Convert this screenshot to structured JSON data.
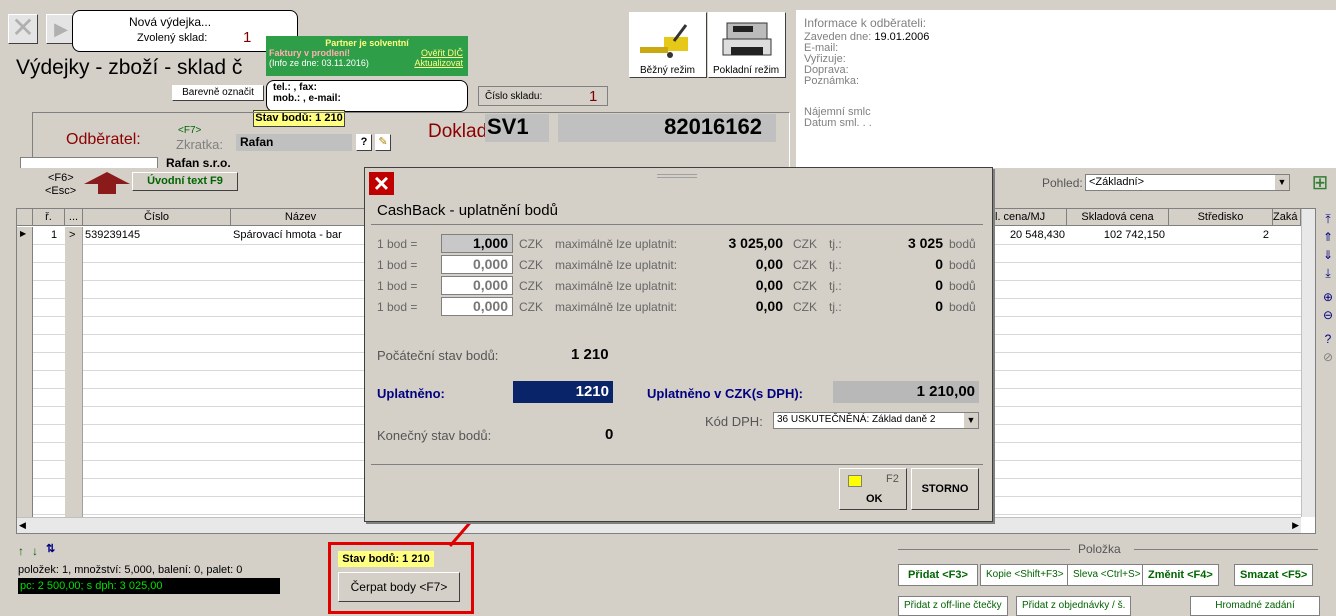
{
  "top": {
    "title": "Výdejky - zboží - sklad č",
    "callout_new": "Nová výdejka...",
    "callout_warehouse_label": "Zvolený sklad:",
    "callout_warehouse_value": "1",
    "partner_title": "Partner je solventní",
    "partner_invoices": "Faktury v prodlení!",
    "partner_verify": "Ověřit DIČ",
    "partner_info": "(Info ze dne: 03.11.2016)",
    "partner_update": "Aktualizovat",
    "color_button": "Barevně označit",
    "contact_line1": "tel.: , fax:",
    "contact_line2": "mob.: , e-mail:",
    "points_state": "Stav bodů: 1 210",
    "warehouse_no_label": "Číslo skladu:",
    "warehouse_no_value": "1",
    "mode_normal": "Běžný režim",
    "mode_cash": "Pokladní režim"
  },
  "customer": {
    "label": "Odběratel:",
    "f7": "<F7>",
    "short_label": "Zkratka:",
    "short_value": "Rafan",
    "help_btn": "?",
    "name_partial": "Rafan s.r.o.",
    "doc_label": "Doklad:",
    "doc_series": "SV1",
    "doc_number": "82016162"
  },
  "info": {
    "title": "Informace k odběrateli:",
    "created_label": "Zaveden dne:",
    "created_value": "19.01.2006",
    "email": "E-mail:",
    "handles": "Vyřizuje:",
    "transport": "Doprava:",
    "note": "Poznámka:",
    "lease": "Nájemní smlc",
    "lease_date": "Datum sml.   . ."
  },
  "toolbar": {
    "f6": "<F6>",
    "esc": "<Esc>",
    "intro_text": "Úvodní text F9",
    "view_label": "Pohled:",
    "view_value": "<Základní>"
  },
  "grid": {
    "headers": [
      "ř.",
      "...",
      "Číslo",
      "Název",
      "l. cena/MJ",
      "Skladová cena",
      "Středisko",
      "Zaká"
    ],
    "row": {
      "n": "1",
      "arrow": ">",
      "number": "539239145",
      "name": "Spárovací hmota - bar",
      "price": "20 548,430",
      "stock_price": "102 742,150",
      "center": "2"
    }
  },
  "status": {
    "items": "položek: 1, množství: 5,000, balení: 0, palet: 0",
    "price": "pc: 2 500,00; s dph: 3 025,00",
    "points": "Stav bodů: 1 210",
    "redeem_button": "Čerpat body <F7>"
  },
  "item_panel": {
    "title": "Položka",
    "add": "Přidat <F3>",
    "copy": "Kopie <Shift+F3>",
    "discount": "Sleva <Ctrl+S>",
    "change": "Změnit <F4>",
    "delete": "Smazat <F5>",
    "add_offline": "Přidat z off-line čtečky",
    "add_order": "Přidat z objednávky / š.",
    "bulk": "Hromadné zadání"
  },
  "dialog": {
    "close": "×",
    "title": "CashBack - uplatnění bodů",
    "rows": [
      {
        "label": "1 bod =",
        "rate": "1,000",
        "cur": "CZK",
        "max_label": "maximálně lze uplatnit:",
        "max": "3 025,00",
        "cur2": "CZK",
        "tj": "tj.:",
        "pts": "3 025",
        "unit": "bodů"
      },
      {
        "label": "1 bod =",
        "rate": "0,000",
        "cur": "CZK",
        "max_label": "maximálně lze uplatnit:",
        "max": "0,00",
        "cur2": "CZK",
        "tj": "tj.:",
        "pts": "0",
        "unit": "bodů"
      },
      {
        "label": "1 bod =",
        "rate": "0,000",
        "cur": "CZK",
        "max_label": "maximálně lze uplatnit:",
        "max": "0,00",
        "cur2": "CZK",
        "tj": "tj.:",
        "pts": "0",
        "unit": "bodů"
      },
      {
        "label": "1 bod =",
        "rate": "0,000",
        "cur": "CZK",
        "max_label": "maximálně lze uplatnit:",
        "max": "0,00",
        "cur2": "CZK",
        "tj": "tj.:",
        "pts": "0",
        "unit": "bodů"
      }
    ],
    "start_label": "Počáteční stav bodů:",
    "start_value": "1 210",
    "used_label": "Uplatněno:",
    "used_value": "1210",
    "used_czk_label": "Uplatněno v CZK(s DPH):",
    "used_czk_value": "1 210,00",
    "vat_label": "Kód DPH:",
    "vat_value": "36 USKUTEČNĚNÁ: Základ daně 2",
    "end_label": "Konečný stav bodů:",
    "end_value": "0",
    "ok_key": "F2",
    "ok": "OK",
    "cancel": "STORNO"
  }
}
